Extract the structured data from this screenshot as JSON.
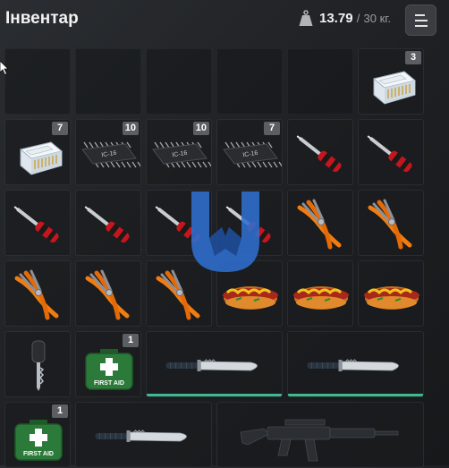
{
  "header": {
    "title": "Інвентар",
    "weight_current": "13.79",
    "weight_separator": "/",
    "weight_max": "30 кг.",
    "weight_icon": "weight-icon",
    "menu_icon": "menu-icon"
  },
  "slots": [
    {
      "item": "empty"
    },
    {
      "item": "empty"
    },
    {
      "item": "empty"
    },
    {
      "item": "empty"
    },
    {
      "item": "empty"
    },
    {
      "item": "ethernet-connector",
      "count": "3"
    },
    {
      "item": "ethernet-connector",
      "count": "7"
    },
    {
      "item": "microchip",
      "count": "10",
      "chip_label": "IC-16"
    },
    {
      "item": "microchip",
      "count": "10",
      "chip_label": "IC-16"
    },
    {
      "item": "microchip",
      "count": "7",
      "chip_label": "IC-16"
    },
    {
      "item": "screwdriver"
    },
    {
      "item": "screwdriver"
    },
    {
      "item": "screwdriver"
    },
    {
      "item": "screwdriver"
    },
    {
      "item": "screwdriver"
    },
    {
      "item": "screwdriver"
    },
    {
      "item": "pliers"
    },
    {
      "item": "pliers"
    },
    {
      "item": "pliers"
    },
    {
      "item": "pliers"
    },
    {
      "item": "pliers"
    },
    {
      "item": "hotdog"
    },
    {
      "item": "hotdog"
    },
    {
      "item": "hotdog"
    },
    {
      "item": "car-key"
    },
    {
      "item": "first-aid-kit",
      "count": "1",
      "kit_label": "FIRST AID"
    },
    {
      "item": "combat-knife",
      "durability_pct": 100
    },
    {
      "item": "combat-knife",
      "durability_pct": 100
    },
    {
      "item": "first-aid-kit",
      "count": "1",
      "kit_label": "FIRST AID"
    },
    {
      "item": "combat-knife"
    },
    {
      "item": "assault-rifle"
    }
  ],
  "colors": {
    "background": "#1d1f22",
    "slot_bg": "#1a1c1f",
    "count_badge": "#5b5e63",
    "durability_bar": "#3fb98f",
    "screwdriver_handle": "#c4161c",
    "pliers_handle": "#f07c12",
    "first_aid_green": "#2c7a3a",
    "watermark_blue": "#2f6fd0"
  },
  "watermark": {
    "icon": "watermark-logo"
  }
}
